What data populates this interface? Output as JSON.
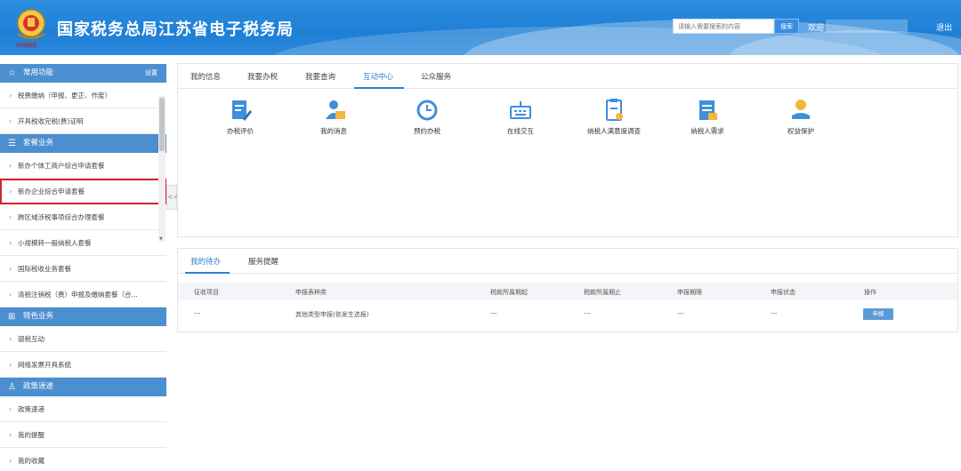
{
  "header": {
    "logo_text": "中国税务",
    "title": "国家税务总局江苏省电子税务局",
    "search_placeholder": "请输入需要搜索的内容",
    "search_button": "搜索",
    "welcome": "欢迎",
    "logout": "退出"
  },
  "sidebar": {
    "common": {
      "title": "常用功能",
      "settings": "设置",
      "items": [
        "税费缴纳（申报、更正、作废）",
        "开具税收完税(费)证明"
      ]
    },
    "package": {
      "title": "套餐业务",
      "items": [
        "新办个体工商户综合申请套餐",
        "新办企业综合申请套餐",
        "跨区域涉税事项综合办理套餐",
        "小规模转一般纳税人套餐",
        "国际税收业务套餐",
        "清税注销税（费）申报及缴纳套餐（合..."
      ]
    },
    "special": {
      "title": "特色业务",
      "items": [
        "银税互动",
        "网络发票开具系统"
      ]
    },
    "policy": {
      "title": "政策速递",
      "items": [
        "政策速递",
        "我的提醒",
        "我的收藏"
      ]
    },
    "collapse_glyph": "<<"
  },
  "top_tabs": [
    "我的信息",
    "我要办税",
    "我要查询",
    "互动中心",
    "公众服务"
  ],
  "active_top_tab": "互动中心",
  "functions": [
    {
      "label": "办税评价",
      "icon": "evaluation-icon"
    },
    {
      "label": "我的消息",
      "icon": "message-icon"
    },
    {
      "label": "预约办税",
      "icon": "clock-icon"
    },
    {
      "label": "在线交互",
      "icon": "keyboard-icon"
    },
    {
      "label": "纳税人满意度调查",
      "icon": "survey-icon"
    },
    {
      "label": "纳税人需求",
      "icon": "request-icon"
    },
    {
      "label": "权益保护",
      "icon": "rights-icon"
    }
  ],
  "bottom_tabs": [
    "我的待办",
    "服务提醒"
  ],
  "table": {
    "headers": [
      "征收项目",
      "申报表种类",
      "税款所属期起",
      "税款所属期止",
      "申报期限",
      "申报状态",
      "操作"
    ],
    "rows": [
      {
        "cells": [
          "---",
          "其他类型申报(依发生选报)",
          "---",
          "---",
          "---",
          "---"
        ],
        "action": "申报"
      }
    ]
  },
  "colors": {
    "header_blue": "#1f7fd6",
    "section_blue": "#4c8fd0",
    "active_tab": "#2f7fd0",
    "highlight_red": "#d3242a"
  }
}
